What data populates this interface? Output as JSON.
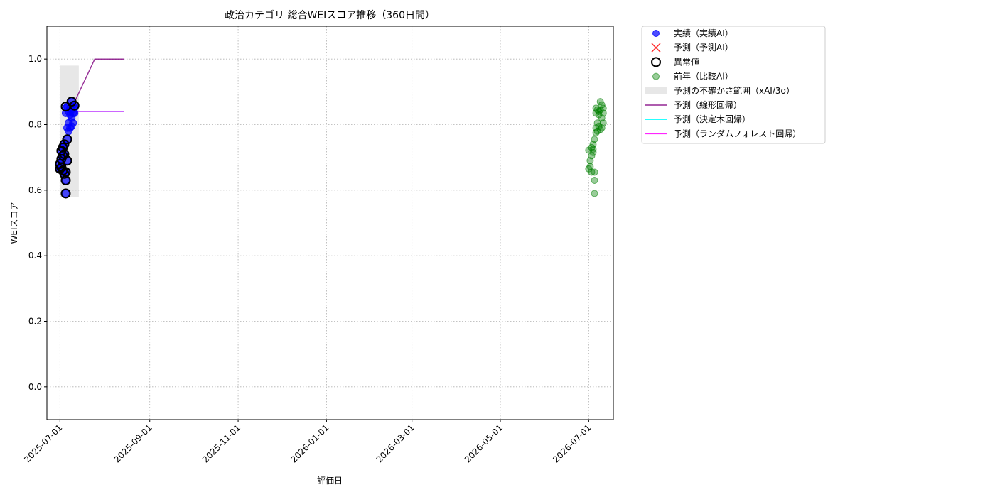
{
  "chart_data": {
    "type": "scatter",
    "title": "政治カテゴリ 総合WEIスコア推移（360日間）",
    "xlabel": "評価日",
    "ylabel": "WEIスコア",
    "x_ticks": [
      "2025-07-01",
      "2025-09-01",
      "2025-11-01",
      "2026-01-01",
      "2026-03-01",
      "2026-05-01",
      "2026-07-01"
    ],
    "xlim": [
      "2025-06-22",
      "2026-07-18"
    ],
    "y_ticks": [
      0.0,
      0.2,
      0.4,
      0.6,
      0.8,
      1.0
    ],
    "ylim": [
      -0.1,
      1.1
    ],
    "grid": true,
    "legend_placement": "outside-top-right",
    "series": [
      {
        "name": "実績（実績AI）",
        "kind": "scatter",
        "color": "#0000ff",
        "points": [
          {
            "x": "2025-07-01",
            "y": 0.665
          },
          {
            "x": "2025-07-01",
            "y": 0.68
          },
          {
            "x": "2025-07-02",
            "y": 0.67
          },
          {
            "x": "2025-07-02",
            "y": 0.695
          },
          {
            "x": "2025-07-02",
            "y": 0.72
          },
          {
            "x": "2025-07-03",
            "y": 0.66
          },
          {
            "x": "2025-07-03",
            "y": 0.705
          },
          {
            "x": "2025-07-03",
            "y": 0.73
          },
          {
            "x": "2025-07-04",
            "y": 0.65
          },
          {
            "x": "2025-07-04",
            "y": 0.74
          },
          {
            "x": "2025-07-04",
            "y": 0.71
          },
          {
            "x": "2025-07-05",
            "y": 0.655
          },
          {
            "x": "2025-07-05",
            "y": 0.63
          },
          {
            "x": "2025-07-05",
            "y": 0.59
          },
          {
            "x": "2025-07-05",
            "y": 0.85
          },
          {
            "x": "2025-07-05",
            "y": 0.835
          },
          {
            "x": "2025-07-06",
            "y": 0.69
          },
          {
            "x": "2025-07-06",
            "y": 0.755
          },
          {
            "x": "2025-07-06",
            "y": 0.79
          },
          {
            "x": "2025-07-06",
            "y": 0.855
          },
          {
            "x": "2025-07-07",
            "y": 0.805
          },
          {
            "x": "2025-07-07",
            "y": 0.78
          },
          {
            "x": "2025-07-07",
            "y": 0.84
          },
          {
            "x": "2025-07-08",
            "y": 0.79
          },
          {
            "x": "2025-07-08",
            "y": 0.83
          },
          {
            "x": "2025-07-08",
            "y": 0.85
          },
          {
            "x": "2025-07-09",
            "y": 0.795
          },
          {
            "x": "2025-07-09",
            "y": 0.82
          },
          {
            "x": "2025-07-09",
            "y": 0.87
          },
          {
            "x": "2025-07-09",
            "y": 0.845
          },
          {
            "x": "2025-07-10",
            "y": 0.835
          },
          {
            "x": "2025-07-10",
            "y": 0.805
          },
          {
            "x": "2025-07-10",
            "y": 0.86
          },
          {
            "x": "2025-07-11",
            "y": 0.85
          },
          {
            "x": "2025-07-11",
            "y": 0.835
          },
          {
            "x": "2025-07-11",
            "y": 0.855
          }
        ]
      },
      {
        "name": "予測（予測AI）",
        "kind": "scatter",
        "color": "#ff0000",
        "points": []
      },
      {
        "name": "異常値",
        "kind": "scatter",
        "color": "#000000",
        "points": [
          {
            "x": "2025-07-01",
            "y": 0.665
          },
          {
            "x": "2025-07-01",
            "y": 0.68
          },
          {
            "x": "2025-07-02",
            "y": 0.67
          },
          {
            "x": "2025-07-02",
            "y": 0.695
          },
          {
            "x": "2025-07-02",
            "y": 0.72
          },
          {
            "x": "2025-07-03",
            "y": 0.66
          },
          {
            "x": "2025-07-03",
            "y": 0.705
          },
          {
            "x": "2025-07-03",
            "y": 0.73
          },
          {
            "x": "2025-07-04",
            "y": 0.65
          },
          {
            "x": "2025-07-04",
            "y": 0.74
          },
          {
            "x": "2025-07-04",
            "y": 0.71
          },
          {
            "x": "2025-07-05",
            "y": 0.655
          },
          {
            "x": "2025-07-05",
            "y": 0.63
          },
          {
            "x": "2025-07-05",
            "y": 0.59
          },
          {
            "x": "2025-07-05",
            "y": 0.855
          },
          {
            "x": "2025-07-06",
            "y": 0.69
          },
          {
            "x": "2025-07-06",
            "y": 0.755
          },
          {
            "x": "2025-07-09",
            "y": 0.87
          },
          {
            "x": "2025-07-11",
            "y": 0.858
          }
        ]
      },
      {
        "name": "前年（比較AI）",
        "kind": "scatter",
        "color": "#008000",
        "points": [
          {
            "x": "2026-07-01",
            "y": 0.665
          },
          {
            "x": "2026-07-01",
            "y": 0.722
          },
          {
            "x": "2026-07-02",
            "y": 0.672
          },
          {
            "x": "2026-07-02",
            "y": 0.69
          },
          {
            "x": "2026-07-03",
            "y": 0.705
          },
          {
            "x": "2026-07-03",
            "y": 0.655
          },
          {
            "x": "2026-07-03",
            "y": 0.73
          },
          {
            "x": "2026-07-04",
            "y": 0.715
          },
          {
            "x": "2026-07-04",
            "y": 0.74
          },
          {
            "x": "2026-07-04",
            "y": 0.725
          },
          {
            "x": "2026-07-05",
            "y": 0.655
          },
          {
            "x": "2026-07-05",
            "y": 0.63
          },
          {
            "x": "2026-07-05",
            "y": 0.59
          },
          {
            "x": "2026-07-05",
            "y": 0.755
          },
          {
            "x": "2026-07-06",
            "y": 0.85
          },
          {
            "x": "2026-07-06",
            "y": 0.835
          },
          {
            "x": "2026-07-06",
            "y": 0.775
          },
          {
            "x": "2026-07-06",
            "y": 0.79
          },
          {
            "x": "2026-07-07",
            "y": 0.845
          },
          {
            "x": "2026-07-07",
            "y": 0.805
          },
          {
            "x": "2026-07-07",
            "y": 0.78
          },
          {
            "x": "2026-07-08",
            "y": 0.84
          },
          {
            "x": "2026-07-08",
            "y": 0.795
          },
          {
            "x": "2026-07-08",
            "y": 0.83
          },
          {
            "x": "2026-07-09",
            "y": 0.87
          },
          {
            "x": "2026-07-09",
            "y": 0.845
          },
          {
            "x": "2026-07-09",
            "y": 0.785
          },
          {
            "x": "2026-07-10",
            "y": 0.82
          },
          {
            "x": "2026-07-10",
            "y": 0.86
          },
          {
            "x": "2026-07-10",
            "y": 0.79
          },
          {
            "x": "2026-07-11",
            "y": 0.85
          },
          {
            "x": "2026-07-11",
            "y": 0.835
          },
          {
            "x": "2026-07-11",
            "y": 0.805
          }
        ]
      },
      {
        "name": "予測の不確かさ範囲（xAI/3σ）",
        "kind": "band",
        "color": "#bbbbbb",
        "x_start": "2025-07-01",
        "x_end": "2025-07-14",
        "y_low": 0.58,
        "y_high": 0.98
      },
      {
        "name": "予測（線形回帰）",
        "kind": "line",
        "color": "#800080",
        "points": [
          {
            "x": "2025-07-08",
            "y": 0.84
          },
          {
            "x": "2025-07-25",
            "y": 1.0
          },
          {
            "x": "2025-08-14",
            "y": 1.0
          }
        ]
      },
      {
        "name": "予測（決定木回帰）",
        "kind": "line",
        "color": "#00ffff",
        "points": [
          {
            "x": "2025-07-11",
            "y": 0.84
          },
          {
            "x": "2025-08-14",
            "y": 0.84
          }
        ]
      },
      {
        "name": "予測（ランダムフォレスト回帰）",
        "kind": "line",
        "color": "#ff00ff",
        "points": [
          {
            "x": "2025-07-11",
            "y": 0.84
          },
          {
            "x": "2025-08-14",
            "y": 0.84
          }
        ]
      }
    ]
  }
}
